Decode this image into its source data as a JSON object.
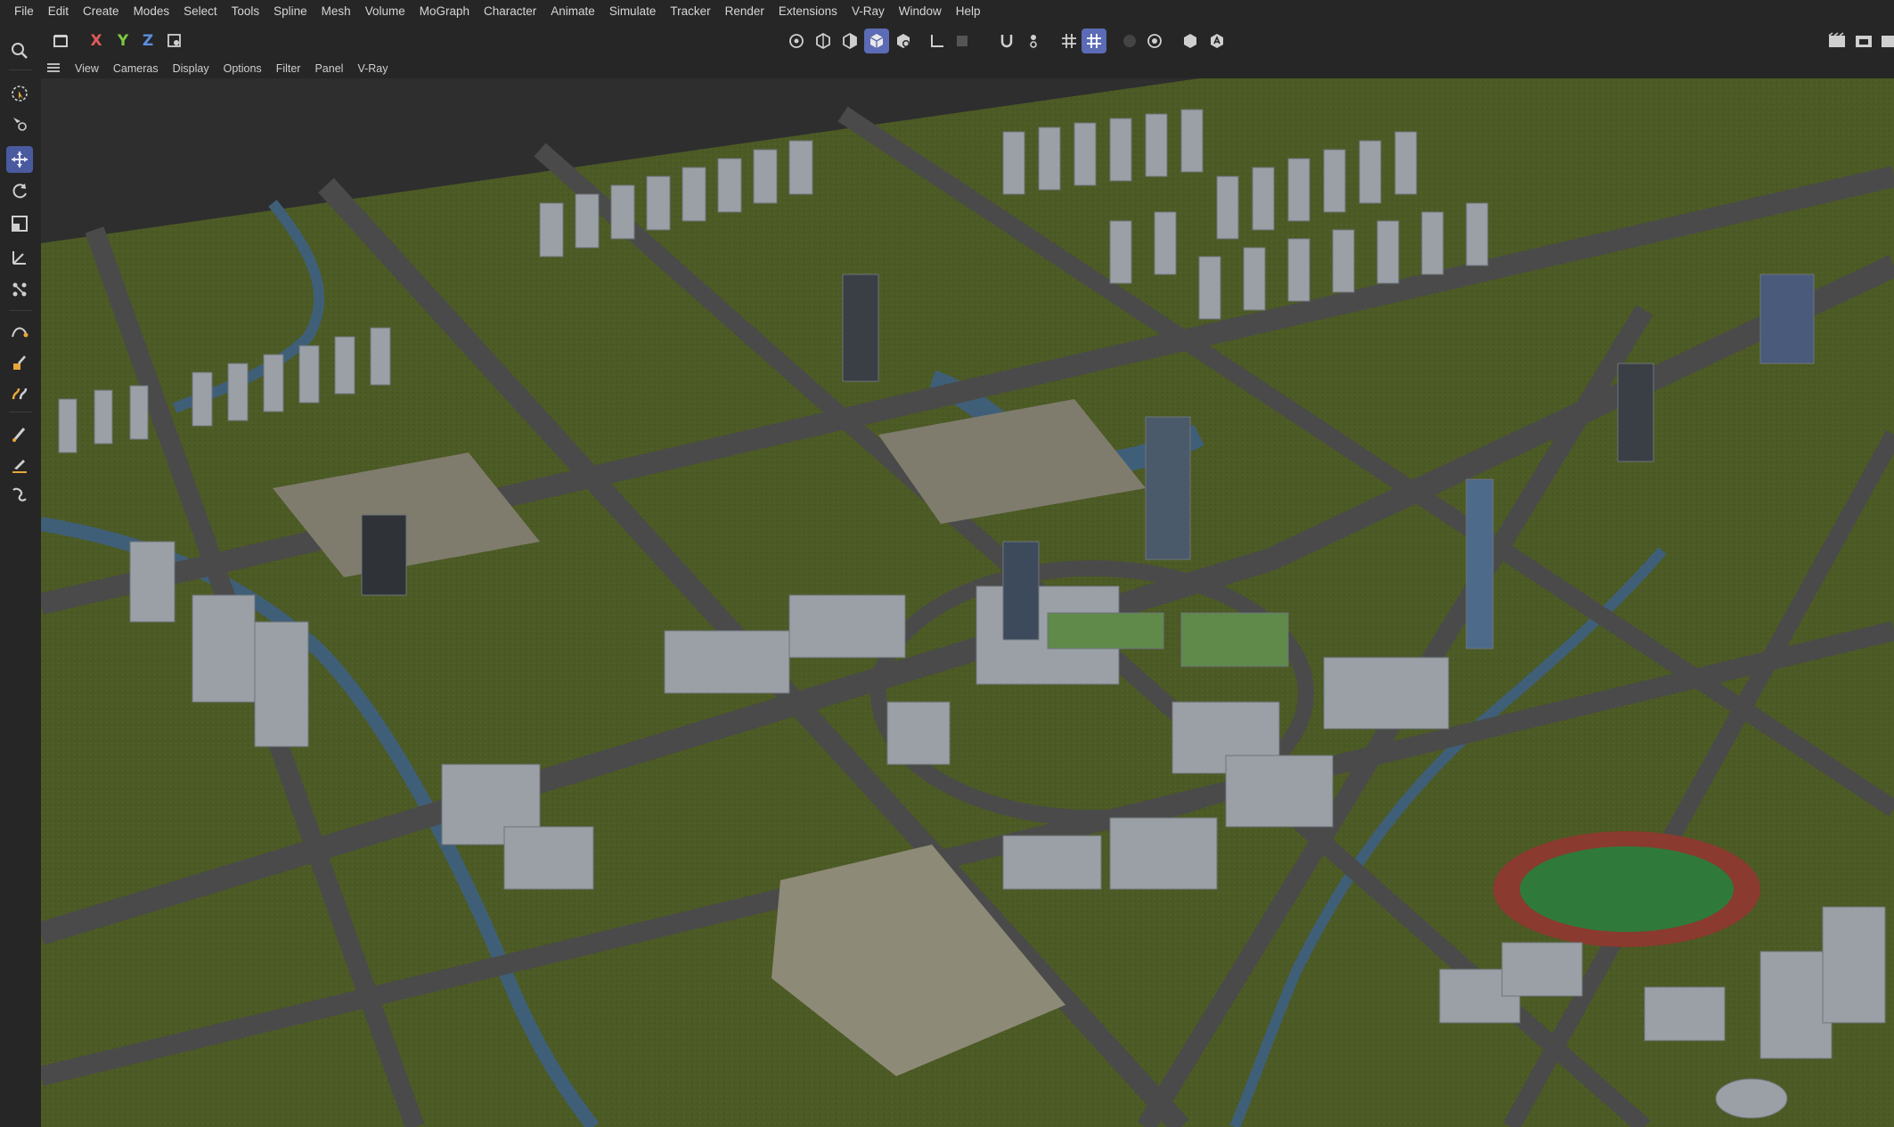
{
  "menu": [
    "File",
    "Edit",
    "Create",
    "Modes",
    "Select",
    "Tools",
    "Spline",
    "Mesh",
    "Volume",
    "MoGraph",
    "Character",
    "Animate",
    "Simulate",
    "Tracker",
    "Render",
    "Extensions",
    "V-Ray",
    "Window",
    "Help"
  ],
  "toolbar": {
    "axis_x": "X",
    "axis_y": "Y",
    "axis_z": "Z",
    "colors": {
      "x": "#e05a5a",
      "y": "#7ac943",
      "z": "#5a8ee0",
      "active": "#5b6bb5"
    }
  },
  "viewport_menu": [
    "View",
    "Cameras",
    "Display",
    "Options",
    "Filter",
    "Panel",
    "V-Ray"
  ],
  "palette_icons": [
    "search-icon",
    "live-selection-icon",
    "selection-tools-icon",
    "move-icon",
    "rotate-icon",
    "scale-icon",
    "transform-icon",
    "snap-transform-icon",
    "spline-pen-icon",
    "paint-icon",
    "sculpt-icon",
    "brush-icon",
    "knife-icon",
    "magnet-icon"
  ],
  "scene": {
    "ground_color": "#4c5a25",
    "road_color": "#4a4a4a",
    "water_color": "#3f5f78",
    "building_color": "#9aa0a6"
  }
}
